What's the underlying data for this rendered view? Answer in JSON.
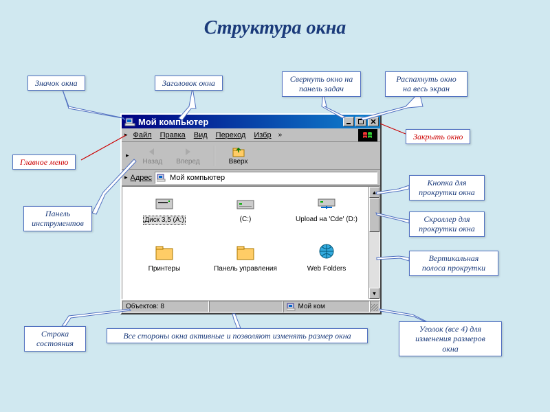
{
  "page_title": "Структура окна",
  "callouts": {
    "window_icon": "Значок окна",
    "titlebar": "Заголовок окна",
    "minimize": "Свернуть окно на панель задач",
    "maximize": "Распахнуть окно на весь экран",
    "close": "Закрыть окно",
    "main_menu": "Главное меню",
    "toolbar": "Панель инструментов",
    "scroll_button": "Кнопка для прокрутки окна",
    "scroller": "Скроллер для прокрутки окна",
    "vscrollbar": "Вертикальная полоса прокрутки",
    "statusbar": "Строка состояния",
    "resize_sides": "Все стороны окна активные и позволяют изменять размер окна",
    "resize_corner": "Уголок  (все 4) для изменения размеров окна"
  },
  "window": {
    "title": "Мой компьютер",
    "menu": [
      "Файл",
      "Правка",
      "Вид",
      "Переход",
      "Избр"
    ],
    "toolbar": {
      "back": "Назад",
      "forward": "Вперед",
      "up": "Вверх"
    },
    "address_label": "Адрес",
    "address_value": "Мой компьютер",
    "items": [
      {
        "label": "Диск 3,5 (A:)",
        "icon": "floppy",
        "selected": true
      },
      {
        "label": "(C:)",
        "icon": "hdd"
      },
      {
        "label": "Upload на 'Cde' (D:)",
        "icon": "netdrive"
      },
      {
        "label": "Принтеры",
        "icon": "folder"
      },
      {
        "label": "Панель управления",
        "icon": "folder"
      },
      {
        "label": "Web Folders",
        "icon": "webfolder"
      }
    ],
    "status_objects": "Объектов: 8",
    "status_location": "Мой ком"
  }
}
